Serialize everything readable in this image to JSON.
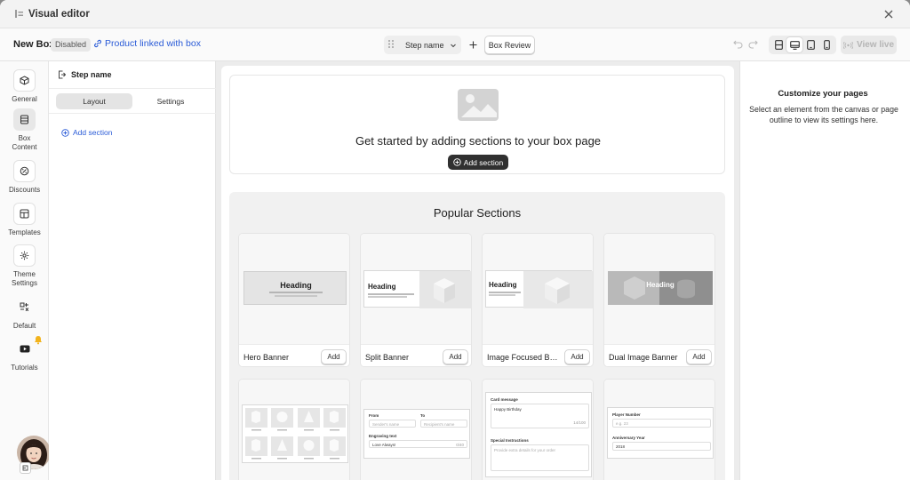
{
  "window": {
    "title": "Visual editor"
  },
  "toolbar": {
    "box_name": "New Box",
    "status_badge": "Disabled",
    "linked_label": "Product linked with box",
    "step_select": "Step name",
    "review_button": "Box Review",
    "view_live": "View live"
  },
  "leftnav": {
    "items": [
      {
        "label": "General",
        "icon": "box-icon"
      },
      {
        "label": "Box Content",
        "icon": "content-icon"
      },
      {
        "label": "Discounts",
        "icon": "discount-icon"
      },
      {
        "label": "Templates",
        "icon": "template-icon"
      },
      {
        "label": "Theme Settings",
        "icon": "gear-icon"
      },
      {
        "label": "Default",
        "icon": "default-icon"
      },
      {
        "label": "Tutorials",
        "icon": "youtube-icon"
      }
    ]
  },
  "steppanel": {
    "title": "Step name",
    "tabs": [
      "Layout",
      "Settings"
    ],
    "add_section": "Add section"
  },
  "canvas": {
    "empty_heading": "Get started by adding sections to your box page",
    "add_section_button": "Add section",
    "popular_title": "Popular Sections",
    "cards": [
      {
        "name": "Hero Banner",
        "add": "Add",
        "preview_heading": "Heading"
      },
      {
        "name": "Split Banner",
        "add": "Add",
        "preview_heading": "Heading"
      },
      {
        "name": "Image Focused Banner",
        "add": "Add",
        "preview_heading": "Heading"
      },
      {
        "name": "Dual Image Banner",
        "add": "Add",
        "preview_heading": "Heading"
      }
    ],
    "row2": {
      "form": {
        "from_label": "From",
        "to_label": "To",
        "from_placeholder": "Sender's name",
        "to_placeholder": "Recipient's name",
        "engraving_label": "Engraving text",
        "engraving_value": "Love Always!",
        "engraving_count": "0/40"
      },
      "message": {
        "card_label": "Card message",
        "card_value": "Happy Birthday",
        "card_count": "14/100",
        "special_label": "Special Instructions",
        "special_placeholder": "Provide extra details for your order"
      },
      "player": {
        "number_label": "Player Number",
        "number_placeholder": "e.g. 23",
        "anniversary_label": "Anniversary Year",
        "anniversary_value": "2018"
      }
    }
  },
  "rightpanel": {
    "title": "Customize your pages",
    "description": "Select an element from the canvas or page outline to view its settings here."
  }
}
